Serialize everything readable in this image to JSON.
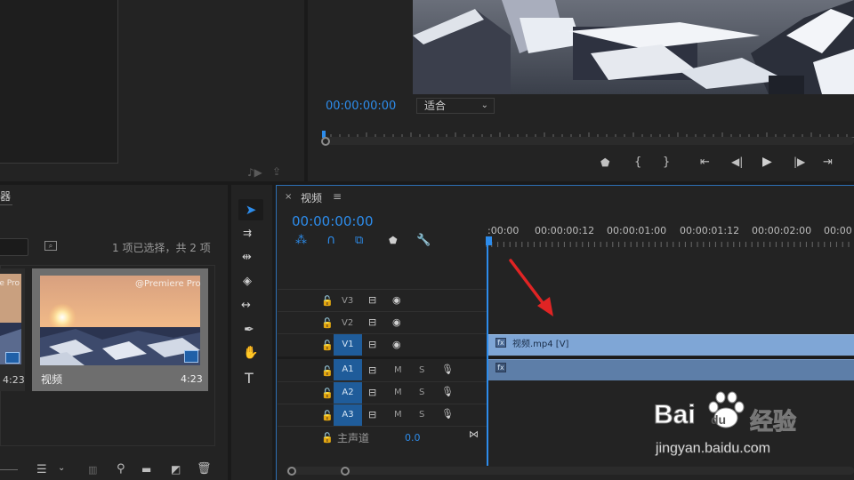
{
  "program_monitor": {
    "timecode": "00:00:00:00",
    "fit": "适合"
  },
  "project": {
    "title": "器",
    "count": "1 项已选择，共 2 项",
    "items": [
      {
        "name": "",
        "duration": "4:23",
        "watermark": "@Premiere Pro"
      },
      {
        "name": "视频",
        "duration": "4:23",
        "watermark": "@Premiere Pro"
      }
    ]
  },
  "timeline": {
    "sequence_name": "视频",
    "timecode": "00:00:00:00",
    "ruler_labels": [
      ":00:00",
      "00:00:00:12",
      "00:00:01:00",
      "00:00:01:12",
      "00:00:02:00",
      "00:00"
    ],
    "tracks_video": [
      "V3",
      "V2",
      "V1"
    ],
    "tracks_audio": [
      "A1",
      "A2",
      "A3"
    ],
    "track_m": "M",
    "track_s": "S",
    "master": {
      "label": "主声道",
      "value": "0.0"
    },
    "clip_label": "视频.mp4 [V]"
  },
  "watermark": {
    "brand_left": "Bai",
    "brand_right": "du",
    "chinese": "经验",
    "url": "jingyan.baidu.com"
  },
  "colors": {
    "accent_blue": "#2d8ceb",
    "clip_blue": "#7fa6d6",
    "audio_clip": "#5d7ea8",
    "arrow_red": "#e02424"
  }
}
